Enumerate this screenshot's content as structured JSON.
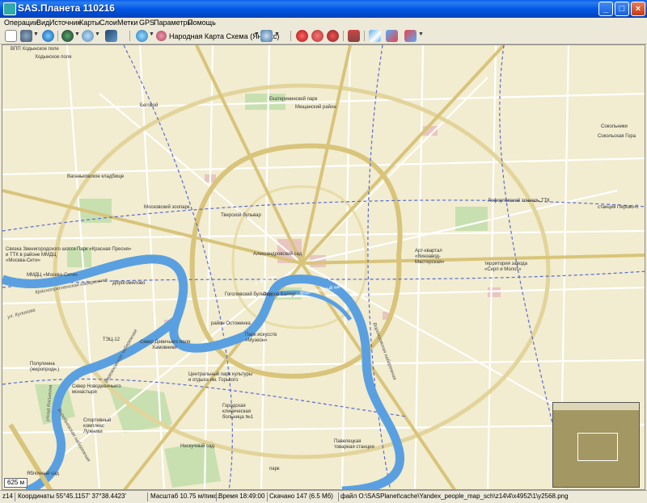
{
  "window": {
    "title": "SAS.Планета 110216"
  },
  "menu": [
    "Операции",
    "Вид",
    "Источник",
    "Карты",
    "Слои",
    "Метки",
    "GPS",
    "Параметры",
    "Помощь"
  ],
  "toolbar": {
    "map_type_label": "Народная Карта Схема (Яндекс)",
    "icons": [
      "move-tool-icon",
      "gps-icon",
      "globe-icon",
      "layers-icon",
      "zoom-icon",
      "screen-icon",
      "map-globe-icon",
      "map-source-icon",
      "layer-globe-icon",
      "marks-icon",
      "marks-edit-icon",
      "marks-delete-icon",
      "save-icon",
      "route-icon",
      "path-icon",
      "path-delete-icon"
    ]
  },
  "map": {
    "labels": [
      "ВПП Ходынское поле",
      "Ходынское поле",
      "Беговой",
      "Екатерининский парк",
      "Мещанский район",
      "Сокольники",
      "Сокольская Гора",
      "Ваганьковское кладбище",
      "Московский зоопарк",
      "Тверской бульвар",
      "Лефортовский тоннель ТТК",
      "станция Перово-II",
      "Связка Звенигородского шоссе и ТТК в районе ММДЦ «Москва-Сити»",
      "Парк «Красная Пресня»",
      "ММДЦ «Москва-Сити»",
      "Дорогомилово",
      "Арт-квартал «Винзавод-Мастерская»",
      "территория завода «Серп и Молот»",
      "Александровский сад",
      "Гоголевский бульвар",
      "Остров Балчуг",
      "Хамовники",
      "район Остоженка",
      "Сквер Девичьего поля",
      "Парк искусств «Музеон»",
      "Центральный парк культуры и отдыха им. Горького",
      "Городская клиническая больница №1",
      "Нескучный сад",
      "Павелецкая товарная станция",
      "Спортивный комплекс Лужники",
      "Яблочный сад",
      "парк",
      "Сквер Новодевичьего монастыря",
      "Полулинна (жиропродн.)",
      "ТЭЦ-12"
    ],
    "roads": [
      "улица Косыгина",
      "Воробьевская набережная",
      "Бережковская набережная",
      "ул. Куликова",
      "Воронцовская набережная",
      "Краснопресненская набережная"
    ],
    "water_labels": [
      "р. Москва",
      "Водоотводный канал"
    ],
    "scale": "625 м",
    "colors": {
      "background": "#f2ecd0",
      "river": "#5aa0e0",
      "ring_road": "#d8c47a",
      "railway": "#5b6bd0",
      "park": "#c8e0b0",
      "building": "#e8c6c0"
    }
  },
  "status": {
    "zoom": "z14",
    "coords": "Координаты 55°45.1157' 37°38.4423'",
    "scale": "Масштаб 10.75 м/пикс.",
    "time": "Время 18:49:00",
    "downloaded": "Скачано 147 (6.5 Мб)",
    "file": "файл O:\\SASPlanet\\cache\\Yandex_people_map_sch\\z14\\4\\x4952\\1\\y2568.png"
  }
}
